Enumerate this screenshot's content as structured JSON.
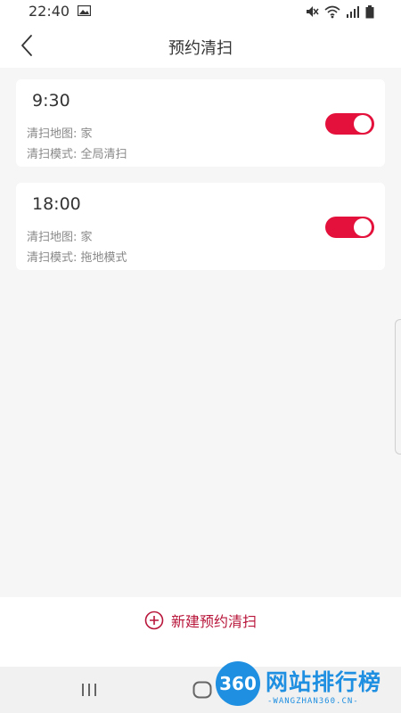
{
  "status_bar": {
    "time": "22:40"
  },
  "header": {
    "title": "预约清扫",
    "back_icon": "chevron-left-icon"
  },
  "schedules": [
    {
      "time": "9:30",
      "map_line": "清扫地图: 家",
      "mode_line": "清扫模式: 全局清扫",
      "enabled": true
    },
    {
      "time": "18:00",
      "map_line": "清扫地图: 家",
      "mode_line": "清扫模式: 拖地模式",
      "enabled": true
    }
  ],
  "footer": {
    "new_label": "新建预约清扫",
    "new_icon": "plus-circle-icon"
  },
  "watermark": {
    "badge": "360",
    "title": "网站排行榜",
    "subtitle": "-WANGZHAN360.CN-"
  },
  "colors": {
    "accent": "#e3113b",
    "accent_text": "#b8153a",
    "background": "#f6f6f6",
    "watermark": "#1e8fe1"
  }
}
